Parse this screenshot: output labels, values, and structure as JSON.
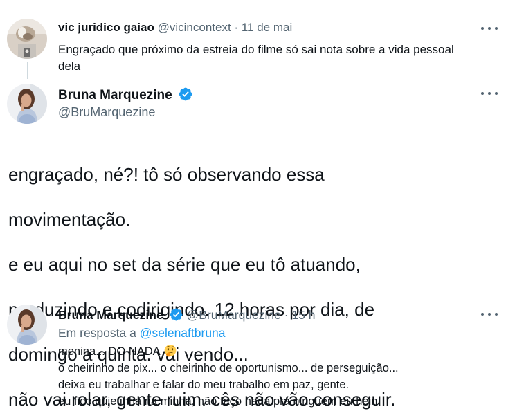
{
  "tweet_quoted": {
    "display_name": "vic juridico gaiao",
    "handle": "@vicincontext",
    "separator": "·",
    "date": "11 de mai",
    "text": "Engraçado que próximo da estreia do filme só sai nota sobre a vida pessoal dela",
    "avatar_icon": "dog-photo-avatar",
    "more_icon": "more-horizontal-icon"
  },
  "main_tweet": {
    "display_name": "Bruna Marquezine",
    "handle": "@BruMarquezine",
    "verified_icon": "verified-badge-icon",
    "avatar_icon": "profile-photo-avatar",
    "more_icon": "more-horizontal-icon",
    "lines": [
      "engraçado, né?! tô só observando essa",
      "movimentação.",
      "e eu aqui no set da série que eu tô atuando,",
      "produzindo e codirigindo. 12 horas por dia, de",
      "domingo a quinta. vai vendo...",
      "não vai rolar, gente ruim. cês não vão conseguir."
    ]
  },
  "reply_tweet": {
    "display_name": "Bruna Marquezine",
    "handle": "@BruMarquezine",
    "separator": "·",
    "time": "15 h",
    "reply_prefix": "Em resposta a",
    "reply_to": "@selenaftbruna",
    "more_icon": "more-horizontal-icon",
    "lines": [
      "menina... DO NADA",
      "o cheirinho de pix... o cheirinho de oportunismo... de perseguição...",
      "deixa eu trabalhar e falar do meu trabalho em paz, gente.",
      "eu fico quietinha na minha, não faço nada pra ninguém eu hein"
    ],
    "emoji_icon": "thinking-face-emoji-icon"
  },
  "colors": {
    "text": "#0f1419",
    "muted": "#536471",
    "accent": "#1d9bf0",
    "thread_line": "#cfd9de"
  }
}
